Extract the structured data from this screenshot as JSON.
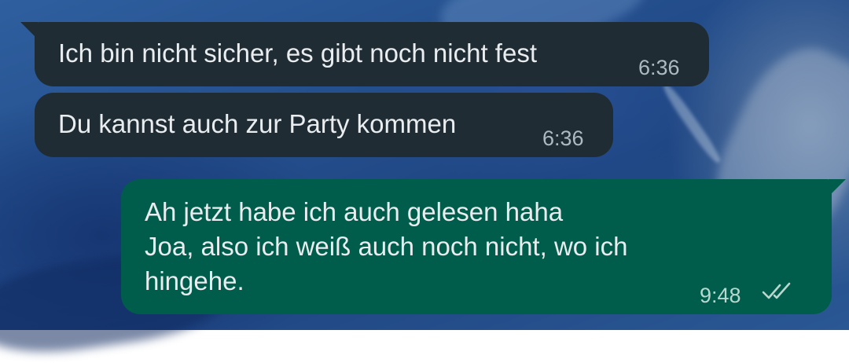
{
  "colors": {
    "incoming_bubble": "#1f2c34",
    "outgoing_bubble": "#005c4b",
    "message_text": "#e9edef",
    "timestamp": "#aebac1"
  },
  "messages": [
    {
      "direction": "incoming",
      "lines": [
        "Ich bin nicht sicher, es gibt noch nicht fest"
      ],
      "time": "6:36"
    },
    {
      "direction": "incoming",
      "lines": [
        "Du kannst auch zur Party kommen"
      ],
      "time": "6:36"
    },
    {
      "direction": "outgoing",
      "lines": [
        "Ah jetzt habe ich auch gelesen haha",
        "Joa, also ich weiß auch noch nicht, wo ich",
        "hingehe."
      ],
      "time": "9:48",
      "status_icon": "double-check-read-icon"
    }
  ]
}
